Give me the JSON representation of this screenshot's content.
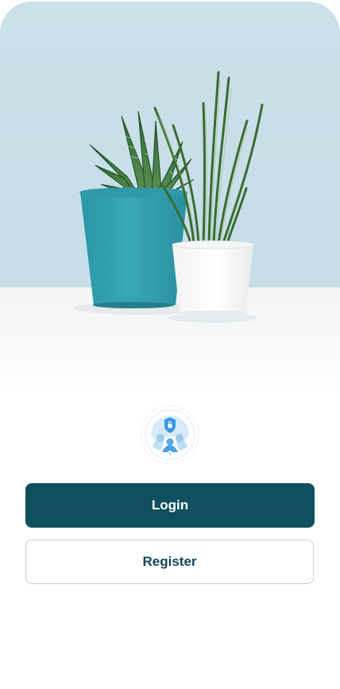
{
  "app": {
    "hero_image": "potted-plants-photo",
    "logo": "security-support-logo",
    "colors": {
      "primary": "#0f505f",
      "primary_text": "#ffffff",
      "secondary_text": "#13465a",
      "border": "#c9ced3",
      "background": "#ffffff"
    }
  },
  "actions": {
    "login_label": "Login",
    "register_label": "Register"
  }
}
